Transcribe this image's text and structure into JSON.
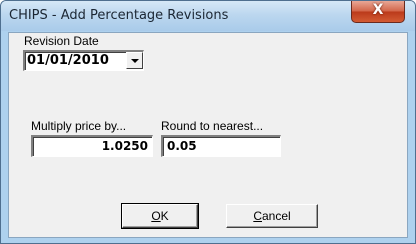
{
  "window": {
    "title": "CHIPS - Add Percentage Revisions",
    "close_glyph": "X"
  },
  "revision_date": {
    "label": "Revision Date",
    "value": "01/01/2010"
  },
  "multiply": {
    "label": "Multiply price by...",
    "value": "1.0250"
  },
  "round": {
    "label": "Round to nearest...",
    "value": "0.05"
  },
  "buttons": {
    "ok_mnemonic": "O",
    "ok_rest": "K",
    "cancel_mnemonic": "C",
    "cancel_rest": "ancel"
  }
}
